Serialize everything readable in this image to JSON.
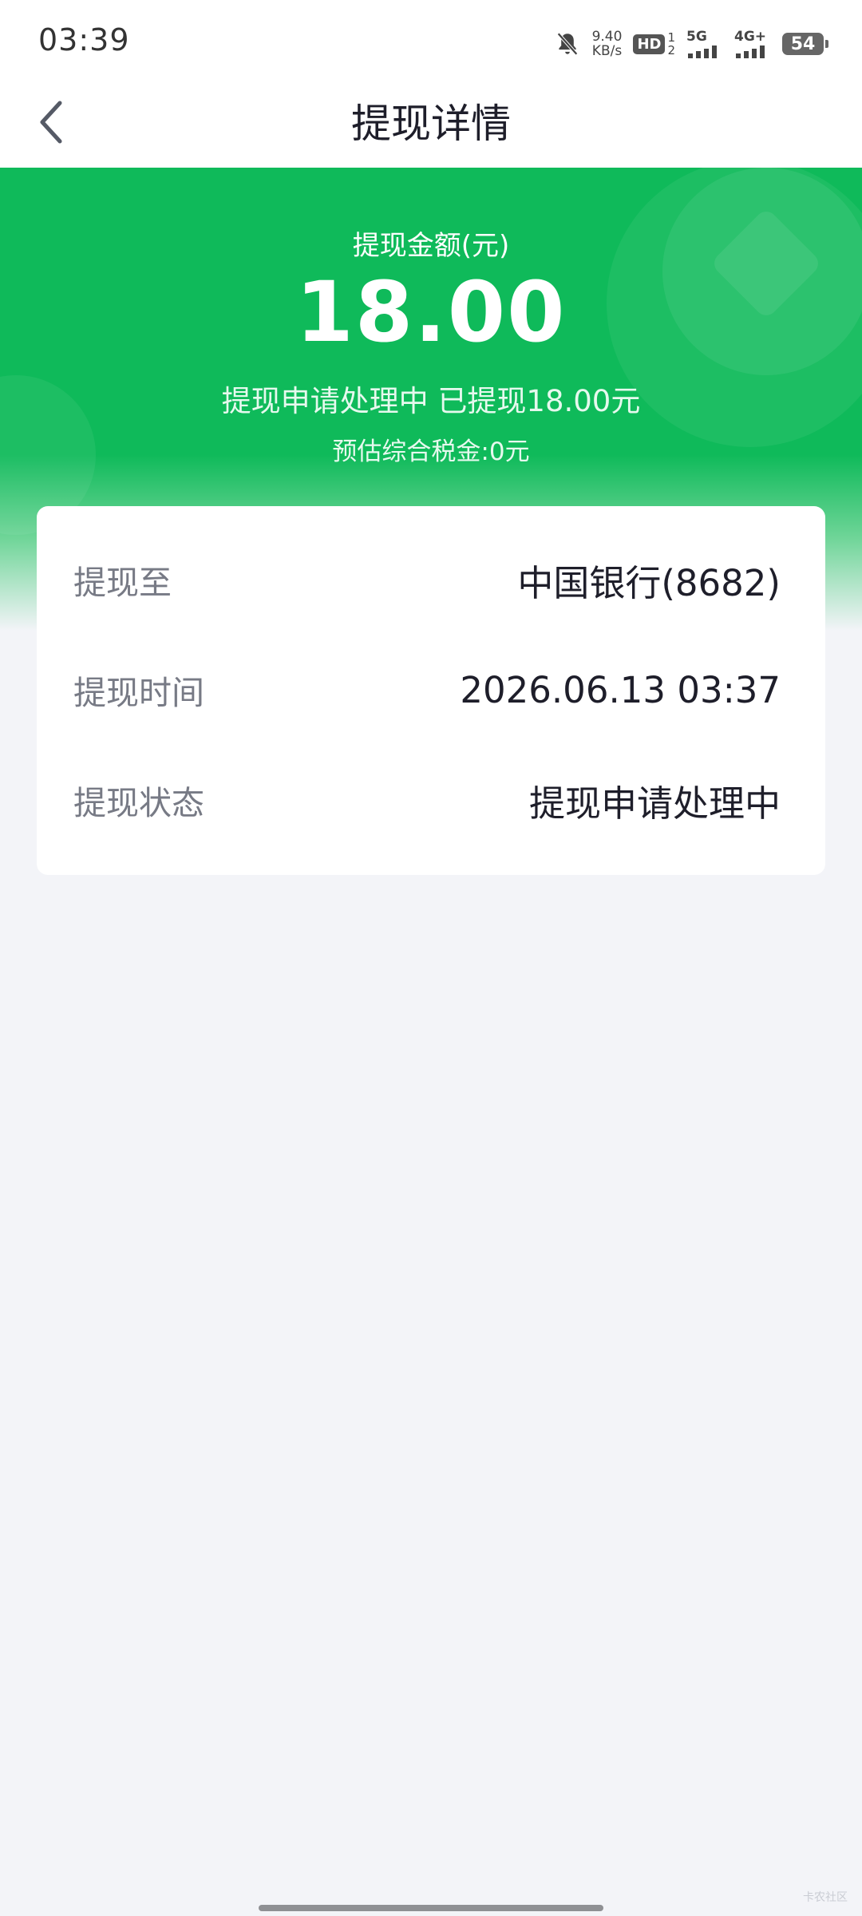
{
  "status_bar": {
    "time": "03:39",
    "net_speed_value": "9.40",
    "net_speed_unit": "KB/s",
    "hd_label": "HD",
    "sim_slot_top": "1",
    "sim_slot_bottom": "2",
    "signal1_label": "5G",
    "signal2_label": "4G+",
    "battery": "54"
  },
  "nav": {
    "title": "提现详情"
  },
  "hero": {
    "amount_label": "提现金额(元)",
    "amount": "18.00",
    "status_text": "提现申请处理中 已提现18.00元",
    "tax_text": "预估综合税金:0元"
  },
  "details": {
    "rows": [
      {
        "label": "提现至",
        "value": "中国银行(8682)"
      },
      {
        "label": "提现时间",
        "value": "2026.06.13 03:37"
      },
      {
        "label": "提现状态",
        "value": "提现申请处理中"
      }
    ]
  },
  "colors": {
    "brand_green": "#0fba5a",
    "page_bg": "#f3f4f8"
  },
  "watermark": "卡农社区"
}
